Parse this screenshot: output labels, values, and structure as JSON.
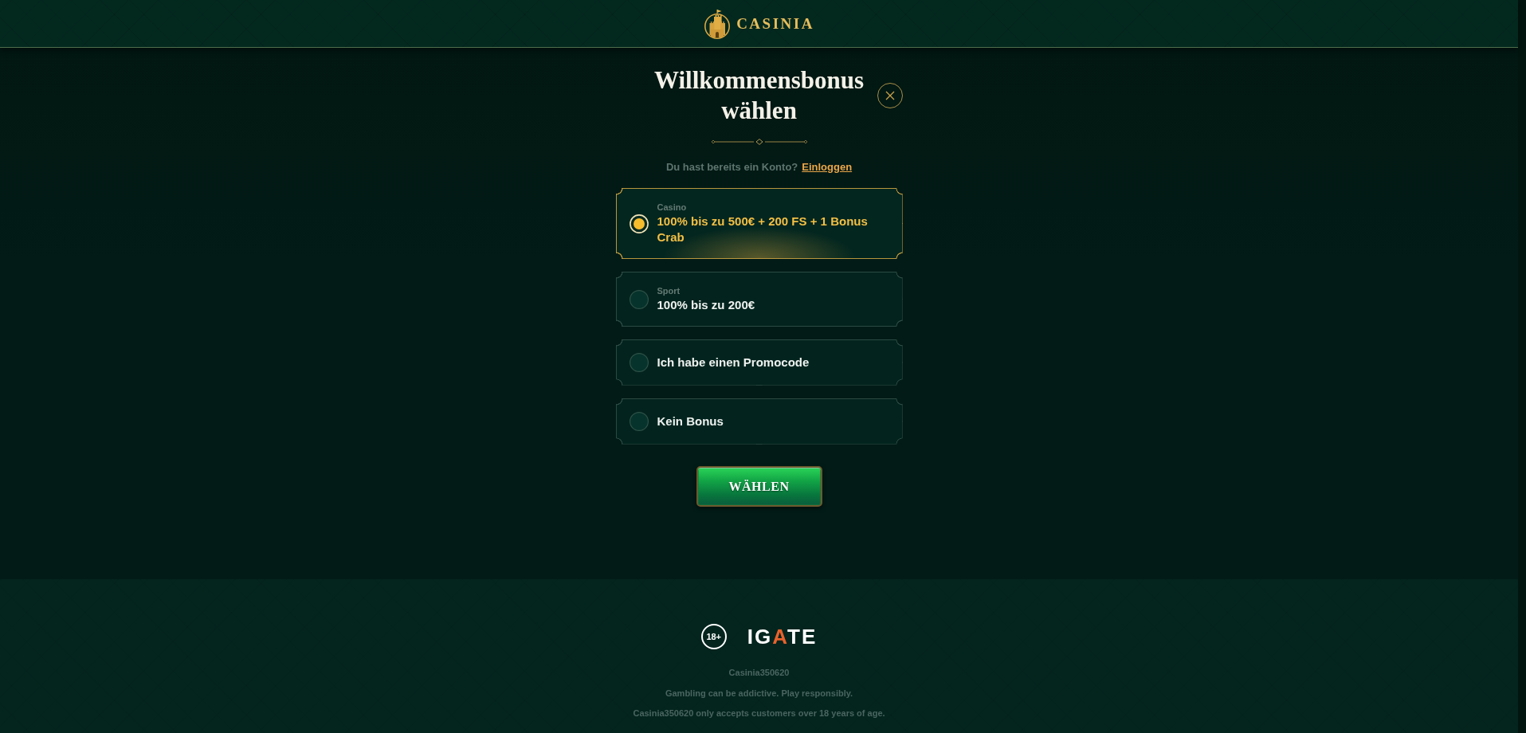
{
  "header": {
    "brand": "CASINIA"
  },
  "dialog": {
    "title": "Willkommensbonus wählen",
    "login_prompt": {
      "question": "Du hast bereits ein Konto?",
      "link": "Einloggen"
    },
    "options": [
      {
        "kind": "offer",
        "category": "Casino",
        "text": "100% bis zu 500€ + 200 FS + 1 Bonus Crab",
        "selected": true
      },
      {
        "kind": "offer",
        "category": "Sport",
        "text": "100% bis zu 200€",
        "selected": false
      },
      {
        "kind": "plain",
        "text": "Ich habe einen Promocode",
        "selected": false
      },
      {
        "kind": "plain",
        "text": "Kein Bonus",
        "selected": false
      }
    ],
    "submit_button": "WÄHLEN"
  },
  "footer": {
    "age_badge": "18+",
    "partner_logo": [
      {
        "text": "IG",
        "accent": false
      },
      {
        "text": "A",
        "accent": true
      },
      {
        "text": "TE",
        "accent": false
      }
    ],
    "lines": [
      "Casinia350620",
      "Gambling can be addictive. Play responsibly.",
      "Casinia350620 only accepts customers over 18 years of age."
    ]
  }
}
